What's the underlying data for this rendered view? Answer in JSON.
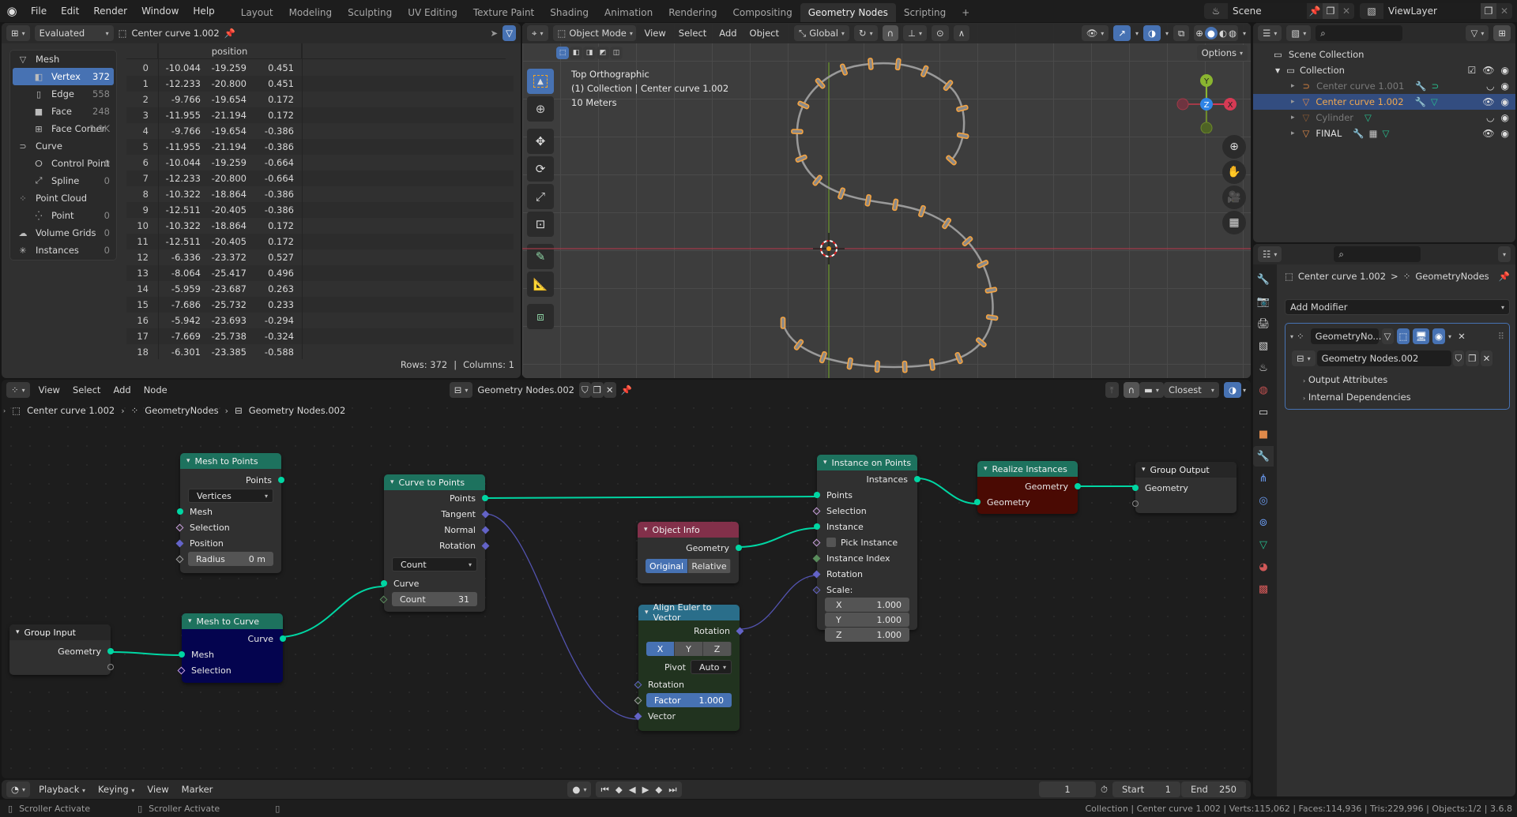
{
  "topbar": {
    "menus": [
      "File",
      "Edit",
      "Render",
      "Window",
      "Help"
    ],
    "workspaces": [
      "Layout",
      "Modeling",
      "Sculpting",
      "UV Editing",
      "Texture Paint",
      "Shading",
      "Animation",
      "Rendering",
      "Compositing",
      "Geometry Nodes",
      "Scripting"
    ],
    "active_workspace": "Geometry Nodes",
    "add_workspace": "+",
    "scene": "Scene",
    "view_layer": "ViewLayer"
  },
  "spreadsheet": {
    "mode": "Evaluated",
    "object": "Center curve 1.002",
    "domains": [
      {
        "label": "Mesh",
        "count": "",
        "icon": "mesh-icon",
        "level": 0
      },
      {
        "label": "Vertex",
        "count": "372",
        "icon": "vertex-icon",
        "level": 1,
        "selected": true
      },
      {
        "label": "Edge",
        "count": "558",
        "icon": "edge-icon",
        "level": 1
      },
      {
        "label": "Face",
        "count": "248",
        "icon": "face-icon",
        "level": 1
      },
      {
        "label": "Face Corner",
        "count": "1.1K",
        "icon": "face-corner-icon",
        "level": 1
      },
      {
        "label": "Curve",
        "count": "",
        "icon": "curve-icon",
        "level": 0
      },
      {
        "label": "Control Point",
        "count": "0",
        "icon": "control-point-icon",
        "level": 1
      },
      {
        "label": "Spline",
        "count": "0",
        "icon": "spline-icon",
        "level": 1
      },
      {
        "label": "Point Cloud",
        "count": "",
        "icon": "point-cloud-icon",
        "level": 0
      },
      {
        "label": "Point",
        "count": "0",
        "icon": "point-icon",
        "level": 1
      },
      {
        "label": "Volume Grids",
        "count": "0",
        "icon": "volume-icon",
        "level": 0
      },
      {
        "label": "Instances",
        "count": "0",
        "icon": "instances-icon",
        "level": 0
      }
    ],
    "column_header": "position",
    "rows": [
      [
        "0",
        "-10.044",
        "-19.259",
        "0.451"
      ],
      [
        "1",
        "-12.233",
        "-20.800",
        "0.451"
      ],
      [
        "2",
        "-9.766",
        "-19.654",
        "0.172"
      ],
      [
        "3",
        "-11.955",
        "-21.194",
        "0.172"
      ],
      [
        "4",
        "-9.766",
        "-19.654",
        "-0.386"
      ],
      [
        "5",
        "-11.955",
        "-21.194",
        "-0.386"
      ],
      [
        "6",
        "-10.044",
        "-19.259",
        "-0.664"
      ],
      [
        "7",
        "-12.233",
        "-20.800",
        "-0.664"
      ],
      [
        "8",
        "-10.322",
        "-18.864",
        "-0.386"
      ],
      [
        "9",
        "-12.511",
        "-20.405",
        "-0.386"
      ],
      [
        "10",
        "-10.322",
        "-18.864",
        "0.172"
      ],
      [
        "11",
        "-12.511",
        "-20.405",
        "0.172"
      ],
      [
        "12",
        "-6.336",
        "-23.372",
        "0.527"
      ],
      [
        "13",
        "-8.064",
        "-25.417",
        "0.496"
      ],
      [
        "14",
        "-5.959",
        "-23.687",
        "0.263"
      ],
      [
        "15",
        "-7.686",
        "-25.732",
        "0.233"
      ],
      [
        "16",
        "-5.942",
        "-23.693",
        "-0.294"
      ],
      [
        "17",
        "-7.669",
        "-25.738",
        "-0.324"
      ],
      [
        "18",
        "-6.301",
        "-23.385",
        "-0.588"
      ]
    ],
    "footer_rows": "Rows: 372",
    "footer_sep": "|",
    "footer_cols": "Columns: 1"
  },
  "viewport": {
    "mode": "Object Mode",
    "menus": [
      "View",
      "Select",
      "Add",
      "Object"
    ],
    "orientation": "Global",
    "options": "Options",
    "overlay_lines": [
      "Top Orthographic",
      "(1) Collection | Center curve 1.002",
      "10 Meters"
    ],
    "gizmo": {
      "y": "Y",
      "z": "Z",
      "x": "X"
    }
  },
  "outliner": {
    "root": "Scene Collection",
    "collection": "Collection",
    "items": [
      {
        "name": "Center curve 1.001",
        "dim": true,
        "selected": false
      },
      {
        "name": "Center curve 1.002",
        "dim": false,
        "selected": true
      },
      {
        "name": "Cylinder",
        "dim": true,
        "selected": false
      },
      {
        "name": "FINAL",
        "dim": false,
        "selected": false
      }
    ]
  },
  "properties": {
    "breadcrumb_object": "Center curve 1.002",
    "breadcrumb_sep": ">",
    "breadcrumb_modifier": "GeometryNodes",
    "add_modifier": "Add Modifier",
    "modifier_name": "GeometryNo...",
    "node_group": "Geometry Nodes.002",
    "subpanels": [
      "Output Attributes",
      "Internal Dependencies"
    ]
  },
  "node_editor": {
    "menus": [
      "View",
      "Select",
      "Add",
      "Node"
    ],
    "node_group": "Geometry Nodes.002",
    "snap_target": "Closest",
    "breadcrumb": [
      "Center curve 1.002",
      "GeometryNodes",
      "Geometry Nodes.002"
    ],
    "nodes": {
      "mesh_to_points": {
        "title": "Mesh to Points",
        "out": "Points",
        "mode": "Vertices",
        "in": [
          "Mesh",
          "Selection",
          "Position"
        ],
        "radius_label": "Radius",
        "radius_value": "0 m"
      },
      "curve_to_points": {
        "title": "Curve to Points",
        "outs": [
          "Points",
          "Tangent",
          "Normal",
          "Rotation"
        ],
        "mode": "Count",
        "in_curve": "Curve",
        "count_label": "Count",
        "count_value": "31"
      },
      "group_input": {
        "title": "Group Input",
        "out": "Geometry"
      },
      "mesh_to_curve": {
        "title": "Mesh to Curve",
        "out": "Curve",
        "in": [
          "Mesh",
          "Selection"
        ]
      },
      "object_info": {
        "title": "Object Info",
        "out": "Geometry",
        "seg": [
          "Original",
          "Relative"
        ],
        "active": "Original"
      },
      "align_euler": {
        "title": "Align Euler to Vector",
        "out": "Rotation",
        "axes": [
          "X",
          "Y",
          "Z"
        ],
        "active_axis": "X",
        "pivot_label": "Pivot",
        "pivot_value": "Auto",
        "in_rotation": "Rotation",
        "factor_label": "Factor",
        "factor_value": "1.000",
        "in_vector": "Vector"
      },
      "instance_on_points": {
        "title": "Instance on Points",
        "out": "Instances",
        "in": [
          "Points",
          "Selection",
          "Instance"
        ],
        "pick": "Pick Instance",
        "index": "Instance Index",
        "rotation": "Rotation",
        "scale": "Scale:",
        "scale_xyz": [
          [
            "X",
            "1.000"
          ],
          [
            "Y",
            "1.000"
          ],
          [
            "Z",
            "1.000"
          ]
        ]
      },
      "realize_instances": {
        "title": "Realize Instances",
        "out": "Geometry",
        "in": "Geometry"
      },
      "group_output": {
        "title": "Group Output",
        "in": "Geometry"
      }
    }
  },
  "timeline": {
    "menus": [
      "Playback",
      "Keying",
      "View",
      "Marker"
    ],
    "current_frame": "1",
    "start_label": "Start",
    "start": "1",
    "end_label": "End",
    "end": "250"
  },
  "statusbar": {
    "hint1": "Scroller Activate",
    "hint2": "Scroller Activate",
    "stats": "Collection | Center curve 1.002 | Verts:115,062 | Faces:114,936 | Tris:229,996 | Objects:1/2 | 3.6.8"
  }
}
